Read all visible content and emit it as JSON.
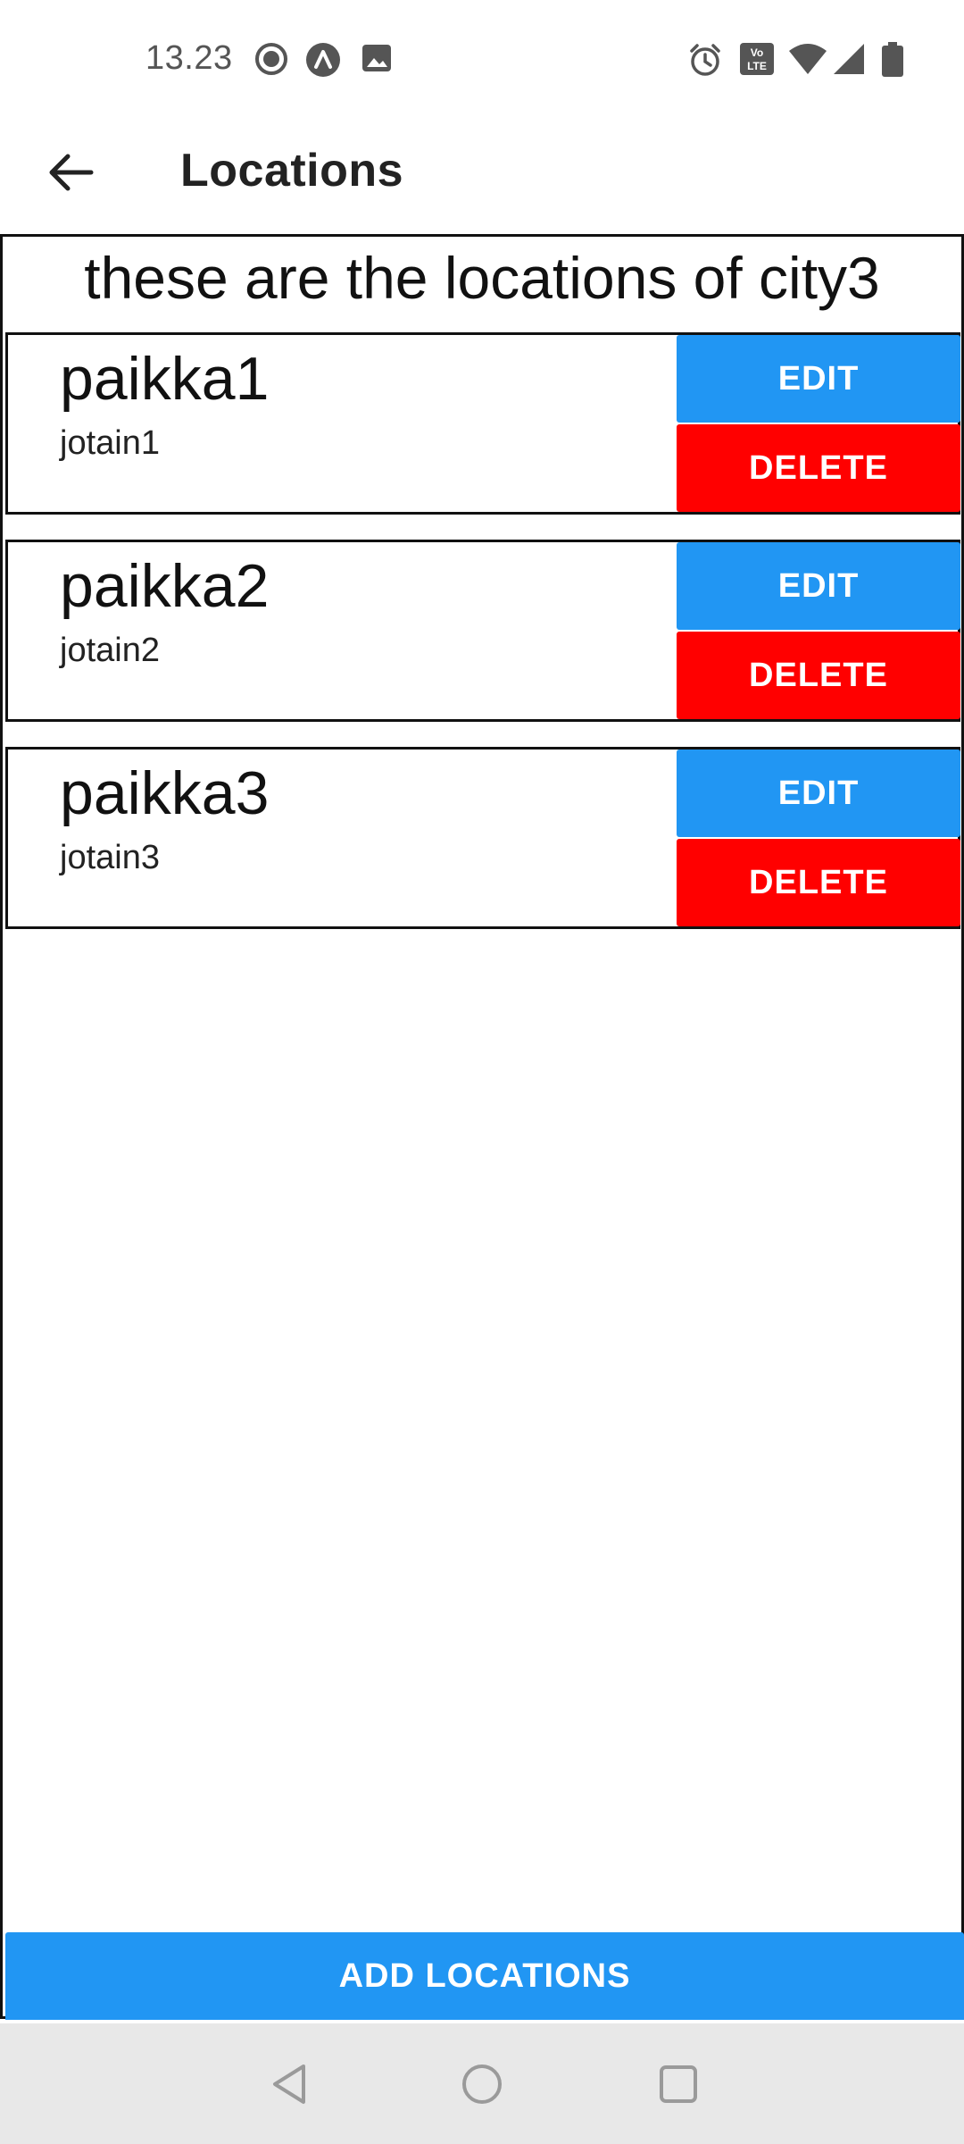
{
  "status_bar": {
    "time": "13.23",
    "left_icons": [
      "record-icon",
      "app-icon",
      "image-icon"
    ],
    "right_icons": [
      "alarm-icon",
      "volte-icon",
      "wifi-icon",
      "signal-icon",
      "battery-icon"
    ],
    "volte_text": "VoLTE"
  },
  "app_bar": {
    "title": "Locations",
    "back_icon": "arrow-left-icon"
  },
  "main": {
    "heading": "these are the locations of city3",
    "items": [
      {
        "name": "paikka1",
        "description": "jotain1",
        "edit_label": "EDIT",
        "delete_label": "DELETE"
      },
      {
        "name": "paikka2",
        "description": "jotain2",
        "edit_label": "EDIT",
        "delete_label": "DELETE"
      },
      {
        "name": "paikka3",
        "description": "jotain3",
        "edit_label": "EDIT",
        "delete_label": "DELETE"
      }
    ],
    "add_button_label": "ADD LOCATIONS"
  },
  "nav_bar": {
    "icons": [
      "nav-back-icon",
      "nav-home-icon",
      "nav-recents-icon"
    ]
  },
  "colors": {
    "primary": "#2196f3",
    "danger": "#ff0000",
    "nav_background": "#e8e8e8"
  }
}
